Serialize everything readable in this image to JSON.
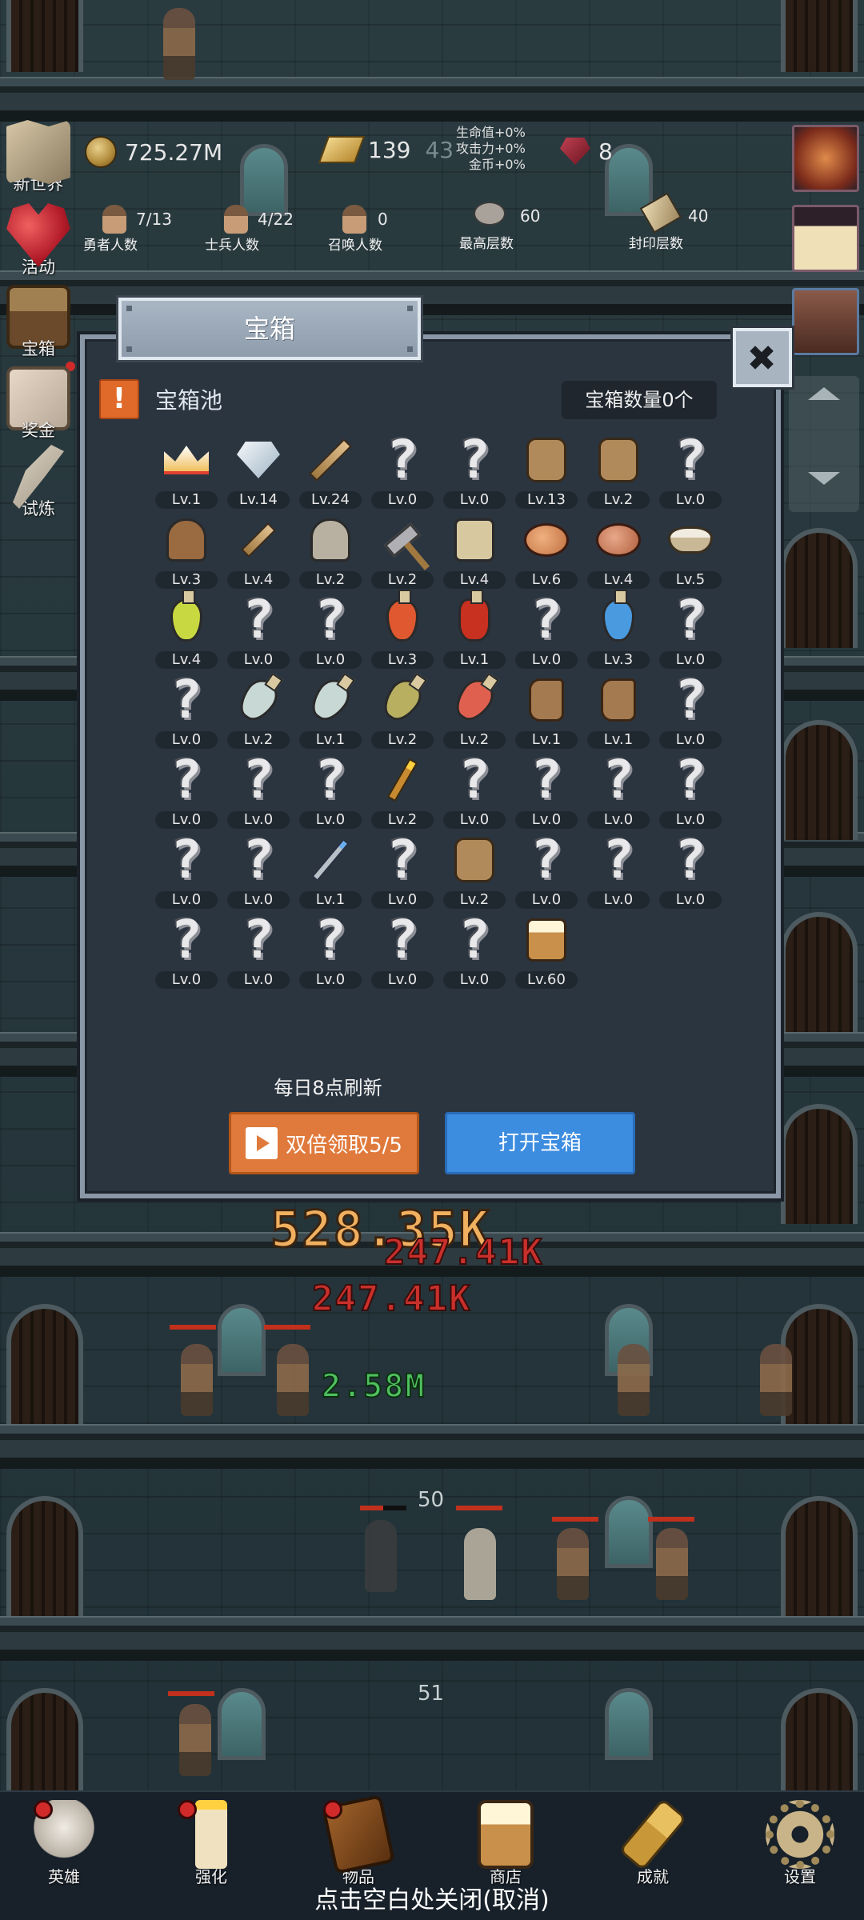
{
  "hud": {
    "coins": "725.27M",
    "gold": "139",
    "gold_extra": "43",
    "bonus_hp": "生命值+0%",
    "bonus_atk": "攻击力+0%",
    "bonus_gold": "金币+0%",
    "gems": "8",
    "heroes_val": "7/13",
    "heroes_label": "勇者人数",
    "soldiers_val": "4/22",
    "soldiers_label": "士兵人数",
    "summon_val": "0",
    "summon_label": "召唤人数",
    "max_floor_val": "60",
    "max_floor_label": "最高层数",
    "seal_val": "40",
    "seal_label": "封印层数"
  },
  "side_menu": [
    {
      "label": "新世界"
    },
    {
      "label": "活动"
    },
    {
      "label": "宝箱"
    },
    {
      "label": "奖金"
    },
    {
      "label": "试炼"
    }
  ],
  "battle": {
    "dmg1": "528.35K",
    "dmg2": "247.41K",
    "dmg3": "247.41K",
    "heal": "2.58M",
    "floor1": "50",
    "floor2": "51"
  },
  "dialog": {
    "title": "宝箱",
    "close_glyph": "✖",
    "warn_glyph": "!",
    "pool_title": "宝箱池",
    "chest_count": "宝箱数量0个",
    "refresh_note": "每日8点刷新",
    "double_button": "双倍领取5/5",
    "open_button": "打开宝箱"
  },
  "items": [
    {
      "icon": "crown-icon",
      "lv": "Lv.1"
    },
    {
      "icon": "diamond-icon",
      "lv": "Lv.14"
    },
    {
      "icon": "sword-icon",
      "lv": "Lv.24"
    },
    {
      "icon": "unknown-icon",
      "lv": "Lv.0"
    },
    {
      "icon": "unknown-icon",
      "lv": "Lv.0"
    },
    {
      "icon": "backpack-icon",
      "lv": "Lv.13"
    },
    {
      "icon": "backpack-icon",
      "lv": "Lv.2"
    },
    {
      "icon": "unknown-icon",
      "lv": "Lv.0"
    },
    {
      "icon": "leather-helmet-icon",
      "lv": "Lv.3"
    },
    {
      "icon": "dagger-icon",
      "lv": "Lv.4"
    },
    {
      "icon": "iron-helmet-icon",
      "lv": "Lv.2"
    },
    {
      "icon": "hammer-icon",
      "lv": "Lv.2"
    },
    {
      "icon": "great-helm-icon",
      "lv": "Lv.4"
    },
    {
      "icon": "ham-icon",
      "lv": "Lv.6"
    },
    {
      "icon": "steak-icon",
      "lv": "Lv.4"
    },
    {
      "icon": "rice-bowl-icon",
      "lv": "Lv.5"
    },
    {
      "icon": "yellow-potion-icon",
      "lv": "Lv.4"
    },
    {
      "icon": "unknown-icon",
      "lv": "Lv.0"
    },
    {
      "icon": "unknown-icon",
      "lv": "Lv.0"
    },
    {
      "icon": "red-potion-icon",
      "lv": "Lv.3"
    },
    {
      "icon": "red-flask-icon",
      "lv": "Lv.1"
    },
    {
      "icon": "unknown-icon",
      "lv": "Lv.0"
    },
    {
      "icon": "blue-potion-icon",
      "lv": "Lv.3"
    },
    {
      "icon": "unknown-icon",
      "lv": "Lv.0"
    },
    {
      "icon": "unknown-icon",
      "lv": "Lv.0"
    },
    {
      "icon": "empty-bottle-icon",
      "lv": "Lv.2"
    },
    {
      "icon": "empty-bottle-icon",
      "lv": "Lv.1"
    },
    {
      "icon": "olive-bottle-icon",
      "lv": "Lv.2"
    },
    {
      "icon": "red-bottle-icon",
      "lv": "Lv.2"
    },
    {
      "icon": "boot-icon",
      "lv": "Lv.1"
    },
    {
      "icon": "boot-icon",
      "lv": "Lv.1"
    },
    {
      "icon": "unknown-icon",
      "lv": "Lv.0"
    },
    {
      "icon": "unknown-icon",
      "lv": "Lv.0"
    },
    {
      "icon": "unknown-icon",
      "lv": "Lv.0"
    },
    {
      "icon": "unknown-icon",
      "lv": "Lv.0"
    },
    {
      "icon": "torch-icon",
      "lv": "Lv.2"
    },
    {
      "icon": "unknown-icon",
      "lv": "Lv.0"
    },
    {
      "icon": "unknown-icon",
      "lv": "Lv.0"
    },
    {
      "icon": "unknown-icon",
      "lv": "Lv.0"
    },
    {
      "icon": "unknown-icon",
      "lv": "Lv.0"
    },
    {
      "icon": "unknown-icon",
      "lv": "Lv.0"
    },
    {
      "icon": "unknown-icon",
      "lv": "Lv.0"
    },
    {
      "icon": "wand-icon",
      "lv": "Lv.1"
    },
    {
      "icon": "unknown-icon",
      "lv": "Lv.0"
    },
    {
      "icon": "backpack-icon",
      "lv": "Lv.2"
    },
    {
      "icon": "unknown-icon",
      "lv": "Lv.0"
    },
    {
      "icon": "unknown-icon",
      "lv": "Lv.0"
    },
    {
      "icon": "unknown-icon",
      "lv": "Lv.0"
    },
    {
      "icon": "unknown-icon",
      "lv": "Lv.0"
    },
    {
      "icon": "unknown-icon",
      "lv": "Lv.0"
    },
    {
      "icon": "unknown-icon",
      "lv": "Lv.0"
    },
    {
      "icon": "unknown-icon",
      "lv": "Lv.0"
    },
    {
      "icon": "unknown-icon",
      "lv": "Lv.0"
    },
    {
      "icon": "beer-mug-icon",
      "lv": "Lv.60"
    }
  ],
  "unknown_glyph": "?",
  "bottom_nav": [
    {
      "label": "英雄",
      "icon": "skull-icon"
    },
    {
      "label": "强化",
      "icon": "candle-icon"
    },
    {
      "label": "物品",
      "icon": "book-icon"
    },
    {
      "label": "商店",
      "icon": "beer-mug-icon"
    },
    {
      "label": "成就",
      "icon": "key-icon"
    },
    {
      "label": "设置",
      "icon": "gear-icon"
    }
  ],
  "close_hint": "点击空白处关闭(取消)"
}
